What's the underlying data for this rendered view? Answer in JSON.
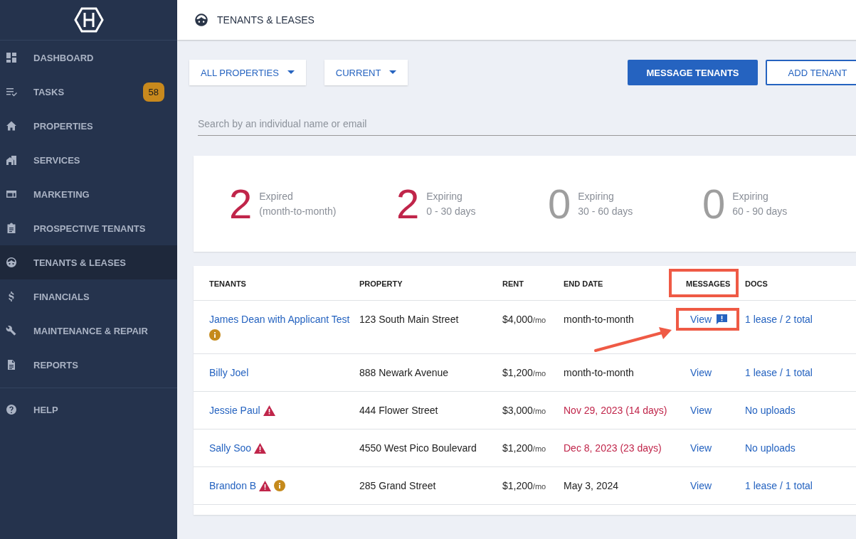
{
  "sidebar": {
    "items": [
      {
        "kind": "dashboard",
        "label": "DASHBOARD",
        "selected": false
      },
      {
        "kind": "tasks",
        "label": "TASKS",
        "selected": false,
        "badge": "58"
      },
      {
        "kind": "properties",
        "label": "PROPERTIES",
        "selected": false
      },
      {
        "kind": "services",
        "label": "SERVICES",
        "selected": false
      },
      {
        "kind": "marketing",
        "label": "MARKETING",
        "selected": false
      },
      {
        "kind": "prospective",
        "label": "PROSPECTIVE TENANTS",
        "selected": false
      },
      {
        "kind": "tenants",
        "label": "TENANTS & LEASES",
        "selected": true
      },
      {
        "kind": "financials",
        "label": "FINANCIALS",
        "selected": false
      },
      {
        "kind": "maintenance",
        "label": "MAINTENANCE & REPAIR",
        "selected": false
      },
      {
        "kind": "reports",
        "label": "REPORTS",
        "selected": false
      }
    ],
    "footer_items": [
      {
        "kind": "help",
        "label": "HELP",
        "selected": false
      }
    ]
  },
  "header": {
    "title": "TENANTS & LEASES"
  },
  "filters": [
    "ALL PROPERTIES",
    "CURRENT"
  ],
  "buttons": {
    "primary": "MESSAGE TENANTS",
    "secondary": "ADD TENANT"
  },
  "search": {
    "placeholder": "Search by an individual name or email"
  },
  "stats": [
    {
      "value": "2",
      "label": "Expired",
      "sublabel": "(month-to-month)",
      "color": "#c0254a"
    },
    {
      "value": "2",
      "label": "Expiring",
      "sublabel": "0 - 30 days",
      "color": "#c0254a"
    },
    {
      "value": "0",
      "label": "Expiring",
      "sublabel": "30 - 60 days",
      "color": "#9e9e9e"
    },
    {
      "value": "0",
      "label": "Expiring",
      "sublabel": "60 - 90 days",
      "color": "#9e9e9e"
    }
  ],
  "table": {
    "columns": [
      {
        "label": "TENANTS",
        "highlighted": false
      },
      {
        "label": "PROPERTY",
        "highlighted": false
      },
      {
        "label": "RENT",
        "highlighted": false
      },
      {
        "label": "END DATE",
        "highlighted": false
      },
      {
        "label": "MESSAGES",
        "highlighted": true
      },
      {
        "label": "DOCS",
        "highlighted": false
      }
    ],
    "rows": [
      {
        "name": "James Dean with Applicant Test",
        "warning": false,
        "info": true,
        "property": "123 South Main Street",
        "rent": "$4,000",
        "rent_unit": "/mo",
        "end_date": "month-to-month",
        "expiring": false,
        "messages": "View",
        "new_message": true,
        "messages_highlighted": true,
        "docs": "1 lease / 2 total"
      },
      {
        "name": "Billy Joel",
        "warning": false,
        "info": false,
        "property": "888 Newark Avenue",
        "rent": "$1,200",
        "rent_unit": "/mo",
        "end_date": "month-to-month",
        "expiring": false,
        "messages": "View",
        "new_message": false,
        "messages_highlighted": false,
        "docs": "1 lease / 1 total"
      },
      {
        "name": "Jessie Paul",
        "warning": true,
        "info": false,
        "property": "444 Flower Street",
        "rent": "$3,000",
        "rent_unit": "/mo",
        "end_date": "Nov 29, 2023 (14 days)",
        "expiring": true,
        "messages": "View",
        "new_message": false,
        "messages_highlighted": false,
        "docs": "No uploads"
      },
      {
        "name": "Sally Soo",
        "warning": true,
        "info": false,
        "property": "4550 West Pico Boulevard",
        "rent": "$1,200",
        "rent_unit": "/mo",
        "end_date": "Dec 8, 2023 (23 days)",
        "expiring": true,
        "messages": "View",
        "new_message": false,
        "messages_highlighted": false,
        "docs": "No uploads"
      },
      {
        "name": "Brandon B",
        "warning": true,
        "info": true,
        "property": "285 Grand Street",
        "rent": "$1,200",
        "rent_unit": "/mo",
        "end_date": "May 3, 2024",
        "expiring": false,
        "messages": "View",
        "new_message": false,
        "messages_highlighted": false,
        "docs": "1 lease / 1 total"
      }
    ]
  }
}
